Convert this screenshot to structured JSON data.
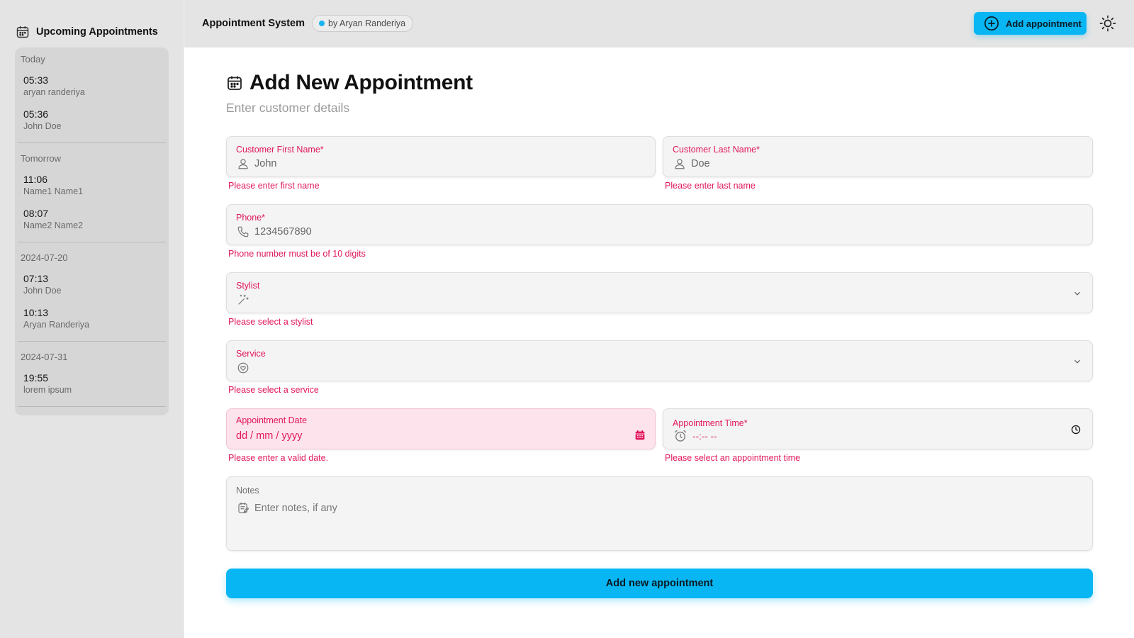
{
  "sidebar": {
    "title": "Upcoming Appointments",
    "groups": [
      {
        "label": "Today",
        "items": [
          {
            "time": "05:33",
            "name": "aryan randeriya"
          },
          {
            "time": "05:36",
            "name": "John Doe"
          }
        ]
      },
      {
        "label": "Tomorrow",
        "items": [
          {
            "time": "11:06",
            "name": "Name1 Name1"
          },
          {
            "time": "08:07",
            "name": "Name2 Name2"
          }
        ]
      },
      {
        "label": "2024-07-20",
        "items": [
          {
            "time": "07:13",
            "name": "John Doe"
          },
          {
            "time": "10:13",
            "name": "Aryan Randeriya"
          }
        ]
      },
      {
        "label": "2024-07-31",
        "items": [
          {
            "time": "19:55",
            "name": "lorem ipsum"
          }
        ]
      }
    ]
  },
  "header": {
    "app_title": "Appointment System",
    "author": "by Aryan Randeriya",
    "add_button": "Add appointment",
    "accent": "#08b6f3"
  },
  "form": {
    "title": "Add New Appointment",
    "subtitle": "Enter customer details",
    "first_name": {
      "label": "Customer First Name",
      "required": "*",
      "placeholder": "John",
      "error": "Please enter first name"
    },
    "last_name": {
      "label": "Customer Last Name",
      "required": "*",
      "placeholder": "Doe",
      "error": "Please enter last name"
    },
    "phone": {
      "label": "Phone",
      "required": "*",
      "placeholder": "1234567890",
      "error": "Phone number must be of 10 digits"
    },
    "stylist": {
      "label": "Stylist",
      "value": "",
      "error": "Please select a stylist"
    },
    "service": {
      "label": "Service",
      "value": "",
      "error": "Please select a service"
    },
    "date": {
      "label": "Appointment Date",
      "placeholder": "dd / mm / yyyy",
      "error": "Please enter a valid date."
    },
    "time": {
      "label": "Appointment Time",
      "required": "*",
      "placeholder": "--:-- --",
      "error": "Please select an appointment time"
    },
    "notes": {
      "label": "Notes",
      "placeholder": "Enter notes, if any"
    },
    "submit": "Add new appointment",
    "error_color": "#e0175d"
  },
  "icons": {
    "sidebar_calendar": "calendar-icon",
    "title_calendar": "calendar-icon",
    "add": "plus-circle-icon",
    "theme": "sun-icon",
    "person": "user-icon",
    "phone": "phone-icon",
    "stylist": "magic-wand-icon",
    "service": "heart-hand-icon",
    "date": "calendar-icon",
    "time": "alarm-clock-icon",
    "notes": "note-icon"
  }
}
